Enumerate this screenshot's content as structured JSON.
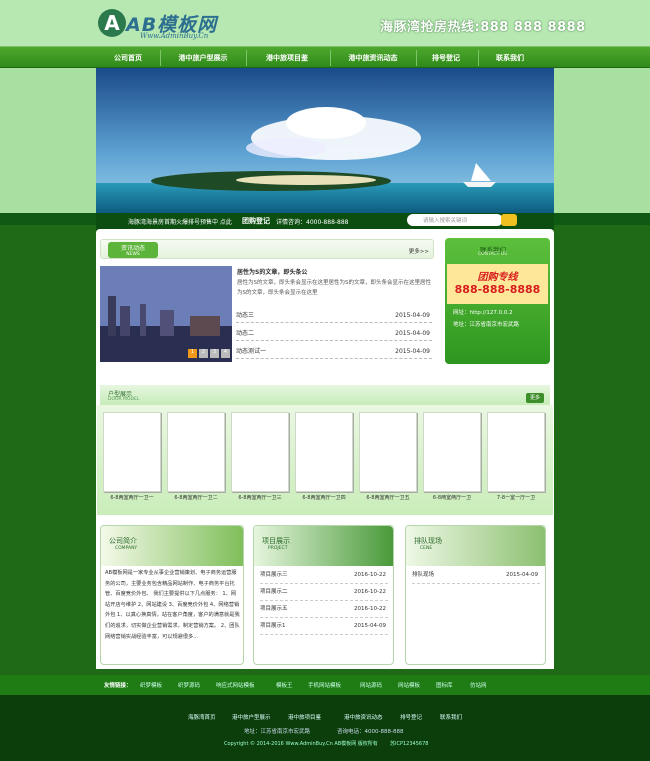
{
  "header": {
    "logo_mark": "A",
    "logo_name": "AB模板网",
    "logo_url": "Www.AdminBuy.Cn",
    "hotline": "海豚湾抢房热线:888 888 8888"
  },
  "nav": [
    "公司首页",
    "港中旅户型展示",
    "港中旅项目鉴",
    "港中旅资讯动态",
    "排号登记",
    "联系我们"
  ],
  "newsbar": {
    "notice": "海豚湾海景房首期火爆排号预售中 点此",
    "group_buy": "团购登记",
    "consult": "详情咨询：4000-888-888",
    "search_placeholder": "请输入搜索关键词"
  },
  "news": {
    "title": "资讯动态",
    "subtitle": "NEWS",
    "more": "更多>>",
    "headline": "居性为S的文章，即头条公",
    "intro": "居性为S的文章，即头条会显示在这里居性为S的文章，即头条会显示在这里居性为S的文章，即头条会显示在这里",
    "pages": [
      "1",
      "2",
      "3",
      "4"
    ],
    "items": [
      {
        "title": "动态三",
        "date": "2015-04-09"
      },
      {
        "title": "动态二",
        "date": "2015-04-09"
      },
      {
        "title": "动态测试一",
        "date": "2015-04-09"
      }
    ]
  },
  "contact": {
    "title": "联系我们",
    "subtitle": "CONTACT US",
    "hotline_label": "团购专线",
    "phone": "888-888-8888",
    "website": "网址：http://127.0.0.2",
    "address": "地址：江苏省南京市宏武路"
  },
  "models": {
    "title": "户型展示",
    "subtitle": "DOOR MODEL",
    "more": "更多",
    "items": [
      "6-8两室两厅一卫一",
      "6-8两室两厅一卫二",
      "6-8两室两厅一卫三",
      "6-8两室两厅一卫四",
      "6-8两室两厅一卫五",
      "6-8两室两厅一卫",
      "7-8一室一厅一卫"
    ]
  },
  "company": {
    "title": "公司简介",
    "subtitle": "COMPANY",
    "text": "AB模板网是一家专业从事企业营销策划、电子商务运营服务的公司，主要业务包含精品网站制作、电子商务平台托管、百度竞价外包、 我们主要提供以下几点服务： 1、网站开店与维护 2、网站建设 3、百度竞价外包 4、网络营销外包 1、以真心换真情，站在客户角度，客户的满意就是我们的追求，切实做企业营销需求，制定营销方案。 2、团队网络营销实战经验丰富，可以规避很多..."
  },
  "projects": {
    "title": "项目展示",
    "subtitle": "PROJECT",
    "items": [
      {
        "title": "项目展示三",
        "date": "2016-10-22"
      },
      {
        "title": "项目展示二",
        "date": "2016-10-22"
      },
      {
        "title": "项目展示五",
        "date": "2016-10-22"
      },
      {
        "title": "项目展示1",
        "date": "2015-04-09"
      }
    ]
  },
  "scene": {
    "title": "排队现场",
    "subtitle": "CENE",
    "items": [
      {
        "title": "排队现场",
        "date": "2015-04-09"
      }
    ]
  },
  "links": {
    "label": "友情链接：",
    "items": [
      "织梦模板",
      "织梦源码",
      "响应式网站模板",
      "模板王",
      "手机网站模板",
      "网站源码",
      "网站模板",
      "图标库",
      "仿站网"
    ]
  },
  "footer": {
    "nav": [
      "海豚湾首页",
      "港中旅户型展示",
      "港中旅项目鉴",
      "港中旅资讯动态",
      "排号登记",
      "联系我们"
    ],
    "address": "地址：江苏省南京市宏武路",
    "phone": "咨询电话：4000-888-888",
    "copyright": "Copyright © 2014-2016 Www.AdminBuy.Cn AB模板网 版权所有",
    "icp": "苏ICP12345678"
  }
}
